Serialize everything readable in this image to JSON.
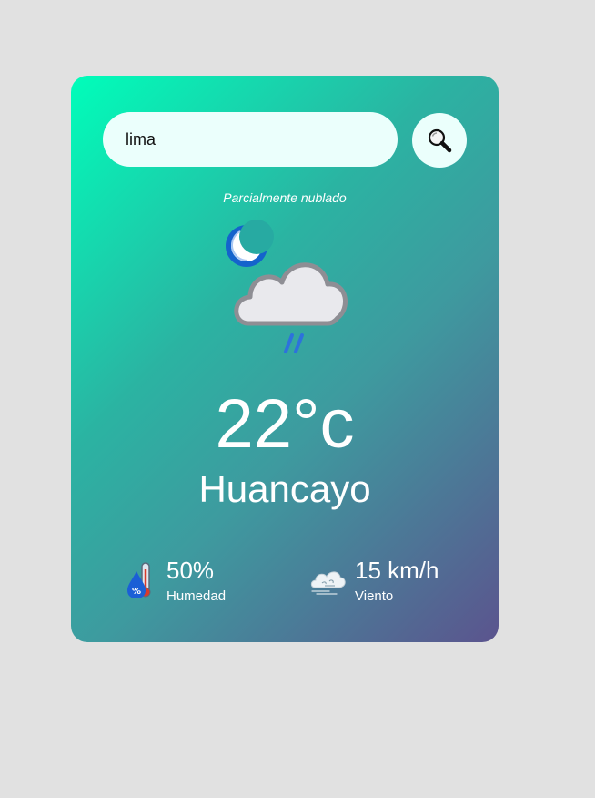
{
  "search": {
    "value": "lima",
    "button_icon": "magnifier-icon"
  },
  "weather": {
    "condition": "Parcialmente nublado",
    "icon": "night-cloud-rain-icon",
    "temperature": "22°c",
    "city": "Huancayo"
  },
  "details": {
    "humidity": {
      "value": "50%",
      "label": "Humedad",
      "icon": "humidity-icon"
    },
    "wind": {
      "value": "15 km/h",
      "label": "Viento",
      "icon": "wind-icon"
    }
  },
  "colors": {
    "background": "#e1e1e1",
    "card_gradient_start": "#00feba",
    "card_gradient_end": "#5b548e",
    "input_background": "#ebfffc",
    "text": "#ffffff"
  }
}
